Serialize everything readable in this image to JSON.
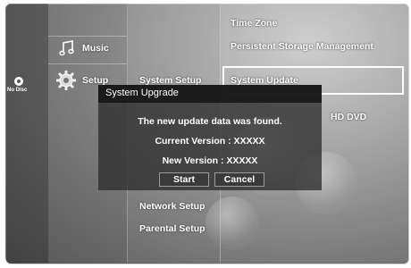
{
  "left": {
    "no_disc": "No Disc"
  },
  "main_menu": {
    "items": [
      {
        "label": "Music"
      },
      {
        "label": "Setup"
      }
    ]
  },
  "sub_menu": {
    "items": [
      {
        "label": "System Setup"
      },
      {
        "label": "Network Setup"
      },
      {
        "label": "Parental Setup"
      }
    ]
  },
  "right_menu": {
    "items": [
      {
        "label": "Time Zone"
      },
      {
        "label": "Persistent Storage Management"
      },
      {
        "label": "System Update"
      },
      {
        "label": "HD DVD"
      }
    ]
  },
  "dialog": {
    "title": "System Upgrade",
    "message": "The new update data was found.",
    "current_version": "Current Version : XXXXX",
    "new_version": "New Version : XXXXX",
    "start_label": "Start",
    "cancel_label": "Cancel"
  }
}
